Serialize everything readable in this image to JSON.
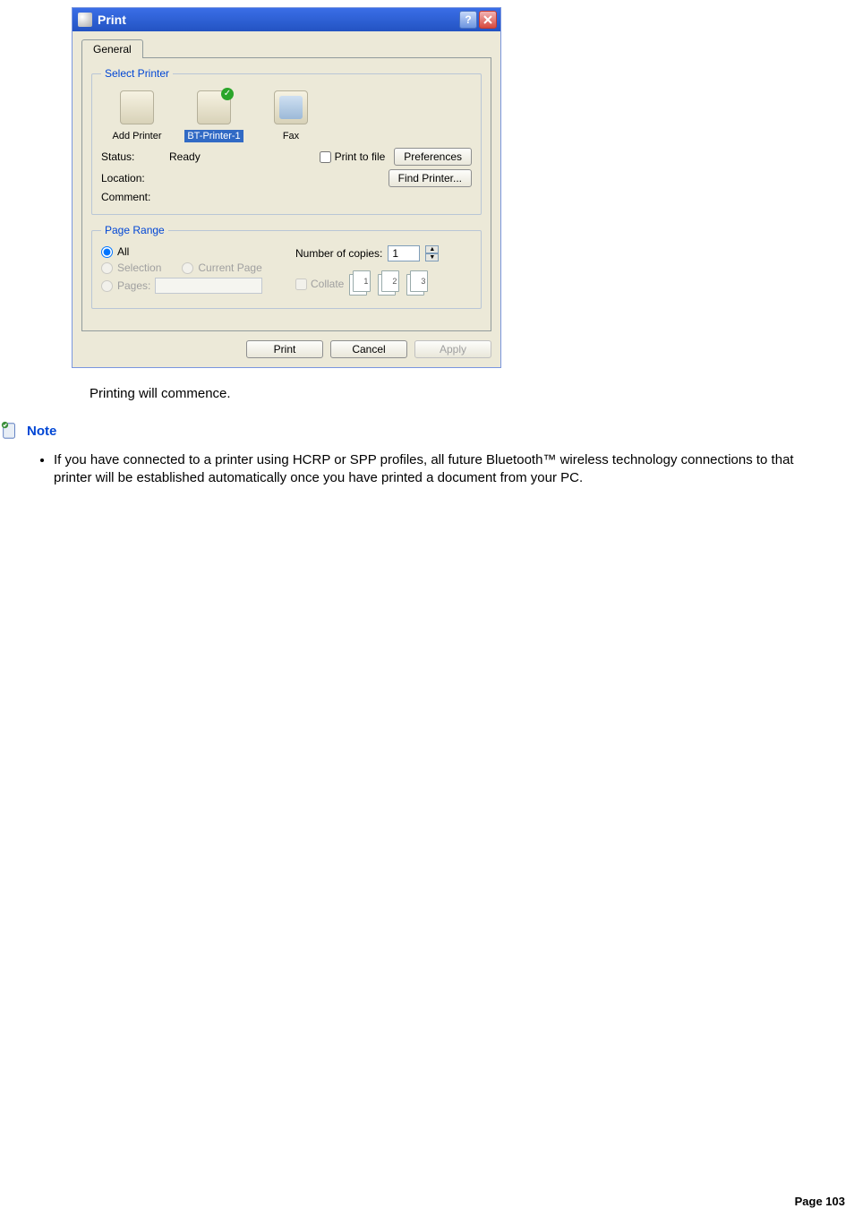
{
  "dialog": {
    "title": "Print",
    "tabs": [
      "General"
    ],
    "select_printer": {
      "legend": "Select Printer",
      "items": [
        {
          "label": "Add Printer"
        },
        {
          "label": "BT-Printer-1",
          "selected": true,
          "checked": true
        },
        {
          "label": "Fax"
        }
      ]
    },
    "status": {
      "status_label": "Status:",
      "status_value": "Ready",
      "location_label": "Location:",
      "location_value": "",
      "comment_label": "Comment:",
      "comment_value": "",
      "print_to_file": "Print to file",
      "preferences_btn": "Preferences",
      "find_printer_btn": "Find Printer..."
    },
    "page_range": {
      "legend": "Page Range",
      "all": "All",
      "selection": "Selection",
      "current_page": "Current Page",
      "pages": "Pages:"
    },
    "copies": {
      "label": "Number of copies:",
      "value": "1",
      "collate": "Collate"
    },
    "buttons": {
      "print": "Print",
      "cancel": "Cancel",
      "apply": "Apply"
    }
  },
  "body_text": "Printing will commence.",
  "note": {
    "heading": "Note",
    "bullets": [
      "If you have connected to a printer using HCRP or SPP profiles, all future Bluetooth™ wireless technology connections to that printer will be established automatically once you have printed a document from your PC."
    ]
  },
  "footer": "Page 103"
}
